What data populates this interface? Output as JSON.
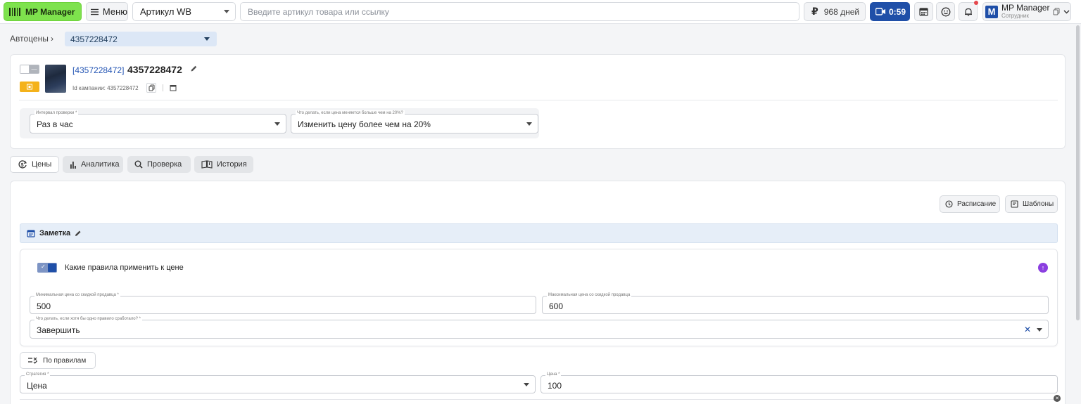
{
  "topbar": {
    "app_button": "MP Manager",
    "menu_label": "Меню",
    "search_type": "Артикул WB",
    "search_placeholder": "Введите артикул товара или ссылку",
    "days_label": "968 дней",
    "timer": "0:59",
    "user_name": "MP Manager",
    "user_role": "Сотрудник",
    "avatar_letter": "M",
    "accent_color": "#1f4fa8",
    "logo_color": "#7ee24d"
  },
  "breadcrumb": {
    "section": "Автоцены",
    "selected": "4357228472"
  },
  "product": {
    "link_id": "[4357228472]",
    "title": "4357228472",
    "campaign_label": "Id кампании: 4357228472",
    "interval_label": "Интервал проверки *",
    "interval_value": "Раз в час",
    "change_label": "Что делать, если цена меняется больше чем на 20%?",
    "change_value": "Изменить цену более чем на 20%"
  },
  "tabs": [
    {
      "label": "Цены",
      "icon": "prices-icon",
      "active": true
    },
    {
      "label": "Аналитика",
      "icon": "bar-chart-icon",
      "active": false
    },
    {
      "label": "Проверка",
      "icon": "search-icon",
      "active": false
    },
    {
      "label": "История",
      "icon": "history-book-icon",
      "active": false
    }
  ],
  "main": {
    "schedule_label": "Расписание",
    "templates_label": "Шаблоны",
    "note_label": "Заметка",
    "rules_title": "Какие правила применить к цене",
    "min_price_label": "Минимальная цена со скидкой продавца *",
    "min_price_value": "500",
    "max_price_label": "Максимальная цена со скидкой продавца",
    "max_price_value": "600",
    "finish_label": "Что делать, если хотя бы одно правило сработало? *",
    "finish_value": "Завершить",
    "by_rules_label": "По правилам",
    "strategy_label": "Стратегия *",
    "strategy_value": "Цена",
    "price_label": "Цена *",
    "price_value": "100"
  }
}
